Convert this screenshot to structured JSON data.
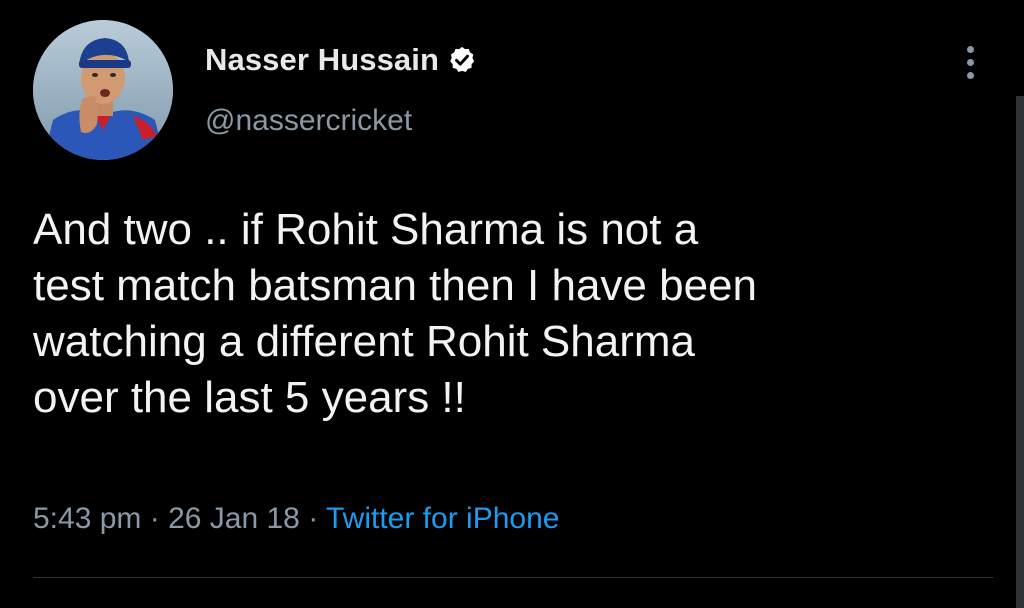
{
  "tweet": {
    "author": {
      "display_name": "Nasser Hussain",
      "handle": "@nassercricket",
      "verified": true,
      "avatar_icon": "profile-photo"
    },
    "text_lines": [
      "And two .. if Rohit Sharma is not a",
      "test match batsman then I have been",
      "watching a different Rohit Sharma",
      "over the last 5 years !!"
    ],
    "time": "5:43 pm",
    "separator": "·",
    "date": "26 Jan 18",
    "source": "Twitter for iPhone",
    "more_icon": "more-vertical-icon"
  },
  "theme": {
    "background": "#000000",
    "text": "#e7e9ea",
    "secondary": "#8b98a5",
    "accent": "#1d9bf0",
    "verified_badge": "#ffffff"
  }
}
